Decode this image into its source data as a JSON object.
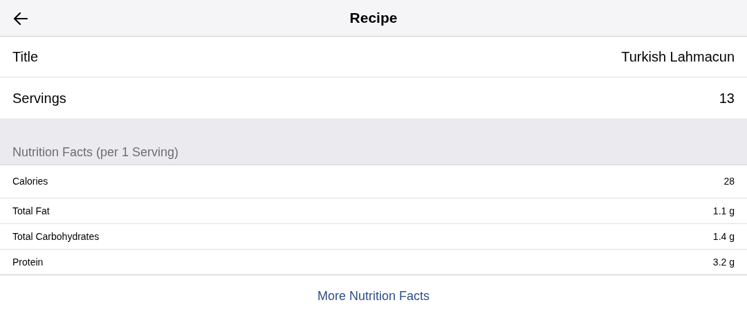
{
  "nav_bar": {
    "title": "Recipe"
  },
  "fields": [
    {
      "label": "Title",
      "value": "Turkish Lahmacun"
    },
    {
      "label": "Servings",
      "value": "13"
    }
  ],
  "nutrition": {
    "header": "Nutrition Facts (per 1 Serving)",
    "rows": [
      {
        "label": "Calories",
        "value": "28"
      },
      {
        "label": "Total Fat",
        "value": "1.1 g"
      },
      {
        "label": "Total Carbohydrates",
        "value": "1.4 g"
      },
      {
        "label": "Protein",
        "value": "3.2 g"
      }
    ],
    "link": "More Nutrition Facts"
  }
}
